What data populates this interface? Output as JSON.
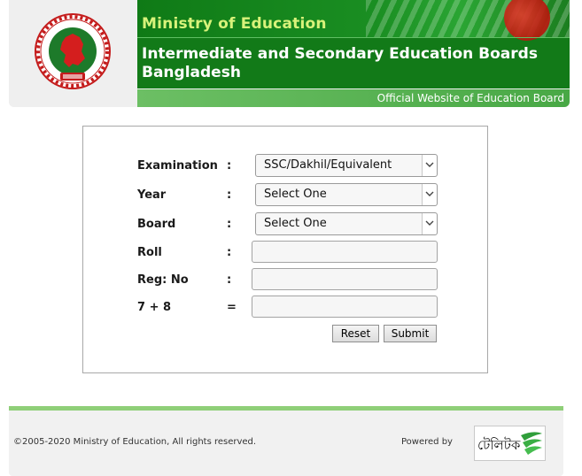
{
  "header": {
    "ministry": "Ministry of Education",
    "board_title": "Intermediate and Secondary Education Boards Bangladesh",
    "official": "Official Website of Education Board",
    "logo_icon": "bangladesh-government-seal-icon"
  },
  "form": {
    "examination": {
      "label": "Examination",
      "sep": ":",
      "value": "SSC/Dakhil/Equivalent"
    },
    "year": {
      "label": "Year",
      "sep": ":",
      "value": "Select One"
    },
    "board": {
      "label": "Board",
      "sep": ":",
      "value": "Select One"
    },
    "roll": {
      "label": "Roll",
      "sep": ":",
      "value": ""
    },
    "reg": {
      "label": "Reg: No",
      "sep": ":",
      "value": ""
    },
    "captcha": {
      "label": "7 + 8",
      "sep": "=",
      "value": ""
    },
    "reset_label": "Reset",
    "submit_label": "Submit"
  },
  "footer": {
    "copyright": "©2005-2020 Ministry of Education, All rights reserved.",
    "powered_by": "Powered by",
    "brand": "টেলিটক",
    "brand_icon": "teletalk-logo-icon"
  },
  "colors": {
    "banner_green": "#127a18",
    "ministry_text": "#d8f27a",
    "subbar_green": "#5cb457",
    "footer_line": "#8fcf78"
  }
}
